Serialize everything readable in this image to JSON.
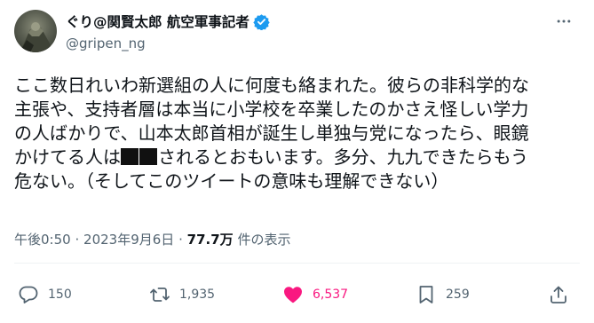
{
  "user": {
    "display_name": "ぐり@関賢太郎 航空軍事記者",
    "handle": "@gripen_ng",
    "verified": true
  },
  "tweet": {
    "lines": [
      "ここ数日れいわ新選組の人に何度も絡まれた。彼らの非科学的な",
      "主張や、支持者層は本当に小学校を卒業したのかさえ怪しい学力",
      "の人ばかりで、山本太郎首相が誕生し単独与党になったら、眼鏡"
    ],
    "line4_prefix": "かけてる人は",
    "line4_suffix": "されるとおもいます。多分、九九できたらもう",
    "line5": "危ない。（そしてこのツイートの意味も理解できない）"
  },
  "meta": {
    "time": "午後0:50",
    "separator": "·",
    "date": "2023年9月6日",
    "views": "77.7万",
    "views_label": "件の表示"
  },
  "actions": {
    "reply_count": "150",
    "retweet_count": "1,935",
    "like_count": "6,537",
    "bookmark_count": "259"
  },
  "colors": {
    "text": "#0f1419",
    "secondary": "#536471",
    "like": "#f91880",
    "verified": "#1d9bf0"
  }
}
